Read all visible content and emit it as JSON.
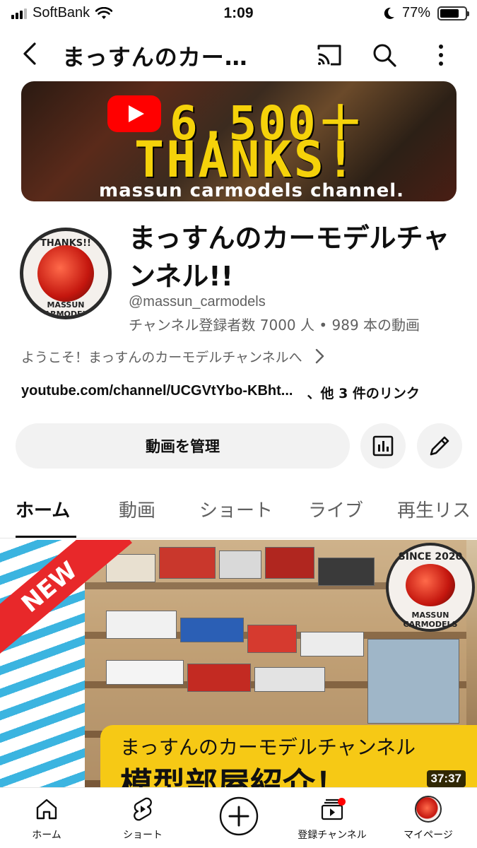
{
  "status_bar": {
    "carrier": "SoftBank",
    "time": "1:09",
    "battery": "77%",
    "battery_level": 0.77
  },
  "top_nav": {
    "title": "まっすんのカー…",
    "back_icon": "back-arrow-icon",
    "cast_icon": "cast-icon",
    "search_icon": "search-icon",
    "more_icon": "more-vertical-icon"
  },
  "banner": {
    "line1": "6,500＋",
    "line2": "THANKS!",
    "line3": "massun carmodels channel."
  },
  "avatar": {
    "top_text": "THANKS!!",
    "bottom_text": "MASSUN CARMODELS"
  },
  "channel": {
    "name": "まっすんのカーモデルチャンネル!!",
    "handle": "@massun_carmodels",
    "stats": "チャンネル登録者数 7000 人 • 989 本の動画",
    "description": "ようこそ！まっすんのカーモデルチャンネルへ",
    "link": "youtube.com/channel/UCGVtYbo-KBht...",
    "other_links": "、他 3 件のリンク"
  },
  "actions": {
    "manage_label": "動画を管理",
    "analytics_icon": "analytics-icon",
    "edit_icon": "pencil-icon"
  },
  "tabs": [
    {
      "label": "ホーム",
      "active": true
    },
    {
      "label": "動画",
      "active": false
    },
    {
      "label": "ショート",
      "active": false
    },
    {
      "label": "ライブ",
      "active": false
    },
    {
      "label": "再生リス",
      "active": false
    }
  ],
  "video": {
    "badge": "NEW",
    "logo_top": "SINCE 2020",
    "logo_bottom": "MASSUN CARMODELS",
    "caption_line1": "まっすんのカーモデルチャンネル",
    "caption_line2": "模型部屋紹介！",
    "duration": "37:37"
  },
  "bottom_nav": [
    {
      "label": "ホーム",
      "icon": "home-icon"
    },
    {
      "label": "ショート",
      "icon": "shorts-icon"
    },
    {
      "label": "",
      "icon": "create-plus-icon"
    },
    {
      "label": "登録チャンネル",
      "icon": "subscriptions-icon"
    },
    {
      "label": "マイページ",
      "icon": "profile-avatar-icon"
    }
  ],
  "colors": {
    "brand_red": "#ff0000",
    "banner_yellow": "#f5d20a",
    "caption_yellow": "#f6c915",
    "text_secondary": "#606060"
  }
}
